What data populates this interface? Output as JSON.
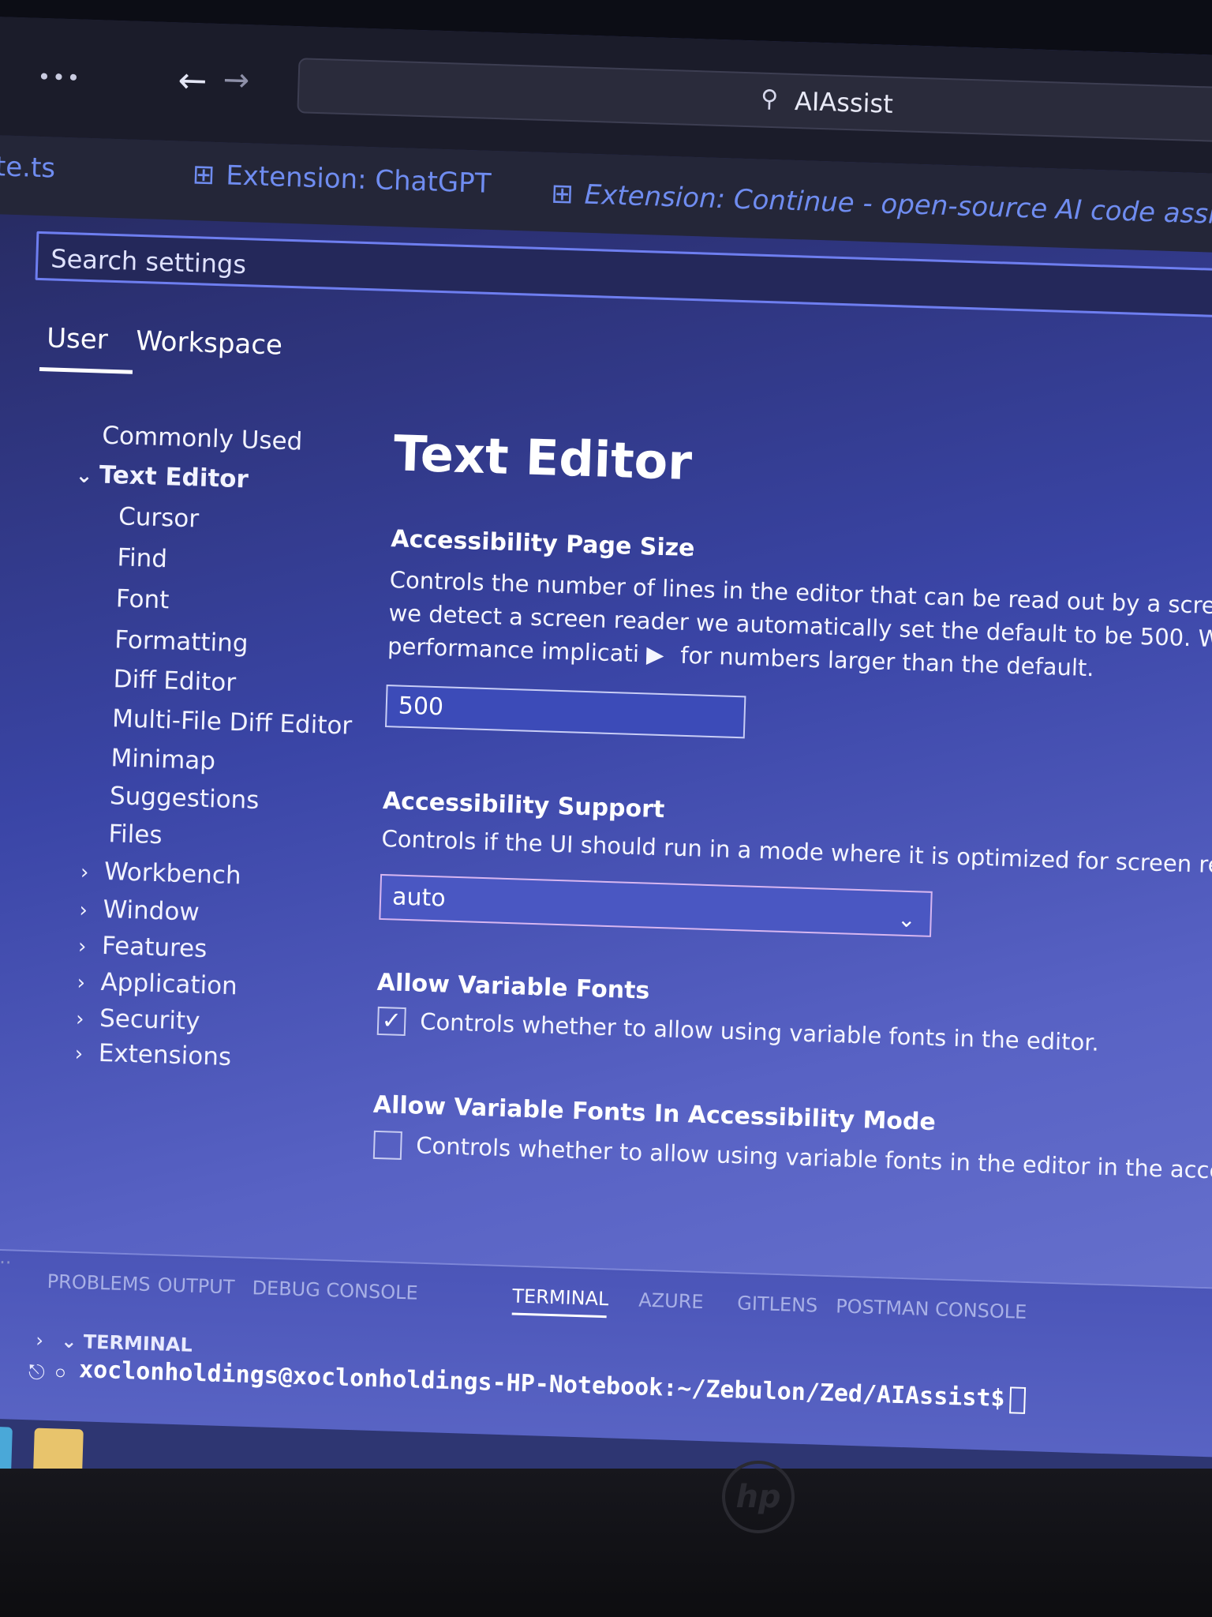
{
  "titlebar": {
    "more_label": "•••",
    "back_icon": "arrow-left-icon",
    "forward_icon": "arrow-right-icon",
    "command_center": "AIAssist"
  },
  "tabs": [
    {
      "label": "te.ts"
    },
    {
      "label": "Extension: ChatGPT"
    },
    {
      "label": "Extension: Continue - open-source AI code assistant"
    }
  ],
  "search": {
    "placeholder": "Search settings"
  },
  "scope_tabs": {
    "user": "User",
    "workspace": "Workspace"
  },
  "toc": [
    {
      "label": "Commonly Used"
    },
    {
      "label": "Text Editor"
    },
    {
      "label": "Cursor"
    },
    {
      "label": "Find"
    },
    {
      "label": "Font"
    },
    {
      "label": "Formatting"
    },
    {
      "label": "Diff Editor"
    },
    {
      "label": "Multi-File Diff Editor"
    },
    {
      "label": "Minimap"
    },
    {
      "label": "Suggestions"
    },
    {
      "label": "Files"
    },
    {
      "label": "Workbench"
    },
    {
      "label": "Window"
    },
    {
      "label": "Features"
    },
    {
      "label": "Application"
    },
    {
      "label": "Security"
    },
    {
      "label": "Extensions"
    }
  ],
  "main": {
    "section_title": "Text Editor",
    "settings": [
      {
        "title": "Accessibility Page Size",
        "desc_lines": [
          "Controls the number of lines in the editor that can be read out by a scre",
          "we detect a screen reader we automatically set the default to be 500. W",
          "performance implicati",
          "for numbers larger than the default."
        ],
        "value": "500"
      },
      {
        "title": "Accessibility Support",
        "desc": "Controls if the UI should run in a mode where it is optimized for screen rea",
        "value": "auto"
      },
      {
        "title": "Allow Variable Fonts",
        "desc": "Controls whether to allow using variable fonts in the editor.",
        "checked": true
      },
      {
        "title": "Allow Variable Fonts In Accessibility Mode",
        "desc": "Controls whether to allow using variable fonts in the editor in the access",
        "checked": false
      }
    ]
  },
  "panel": {
    "tabs": [
      "PROBLEMS",
      "OUTPUT",
      "DEBUG CONSOLE",
      "TERMINAL",
      "AZURE",
      "GITLENS",
      "POSTMAN CONSOLE"
    ],
    "active_tab": "TERMINAL",
    "terminal_header": "TERMINAL",
    "prompt": "xoclonholdings@xoclonholdings-HP-Notebook:~/Zebulon/Zed/AIAssist$"
  },
  "sidebar_truncated": "UD...",
  "brand": {
    "logo": "hp"
  },
  "colors": {
    "accent": "#6e7ef0",
    "tab_text": "#6f8cf0"
  }
}
